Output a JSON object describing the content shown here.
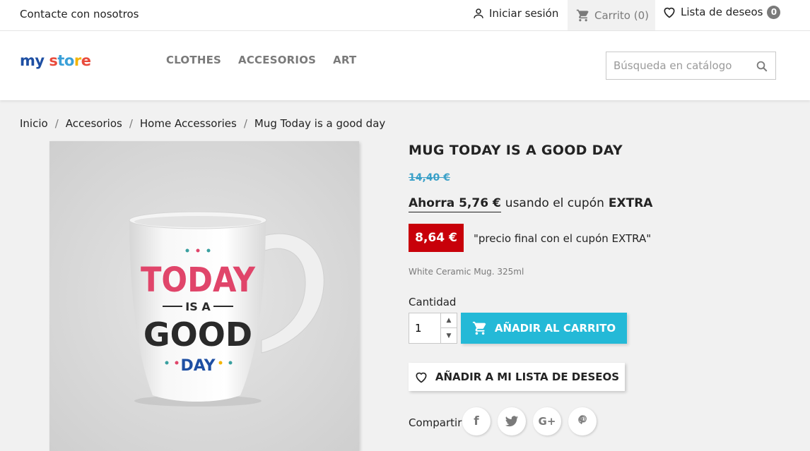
{
  "topbar": {
    "contact": "Contacte con nosotros",
    "login": "Iniciar sesión",
    "cart": "Carrito (0)",
    "wishlist": "Lista de deseos",
    "wishlist_count": "0"
  },
  "header": {
    "logo": {
      "w1": "my",
      "w2": "s",
      "w3": "to",
      "w4": "r",
      "w5": "e"
    },
    "nav": [
      "CLOTHES",
      "ACCESORIOS",
      "ART"
    ],
    "search_placeholder": "Búsqueda en catálogo"
  },
  "breadcrumb": [
    "Inicio",
    "Accesorios",
    "Home Accessories",
    "Mug Today is a good day"
  ],
  "product": {
    "title": "MUG TODAY IS A GOOD DAY",
    "old_price": "14,40 €",
    "save_label": "Ahorra 5,76 €",
    "coupon_text": "usando el cupón",
    "coupon_code": "EXTRA",
    "final_price": "8,64 €",
    "final_text": "\"precio final con el cupón EXTRA\"",
    "description": "White Ceramic Mug. 325ml",
    "quantity_label": "Cantidad",
    "quantity_value": "1",
    "add_to_cart": "AÑADIR AL CARRITO",
    "add_to_wishlist": "AÑADIR A MI LISTA DE DESEOS",
    "share_label": "Compartir",
    "mug_text": {
      "line1": "TODAY",
      "line2": "IS A",
      "line3": "GOOD",
      "line4": "DAY"
    }
  },
  "share": [
    {
      "icon": "facebook-icon",
      "glyph": "f"
    },
    {
      "icon": "twitter-icon",
      "glyph": "t"
    },
    {
      "icon": "google-plus-icon",
      "glyph": "G+"
    },
    {
      "icon": "pinterest-icon",
      "glyph": "P"
    }
  ],
  "colors": {
    "accent": "#24b9d7",
    "price_badge": "#c8000a",
    "old_price": "#3aa0c8"
  }
}
